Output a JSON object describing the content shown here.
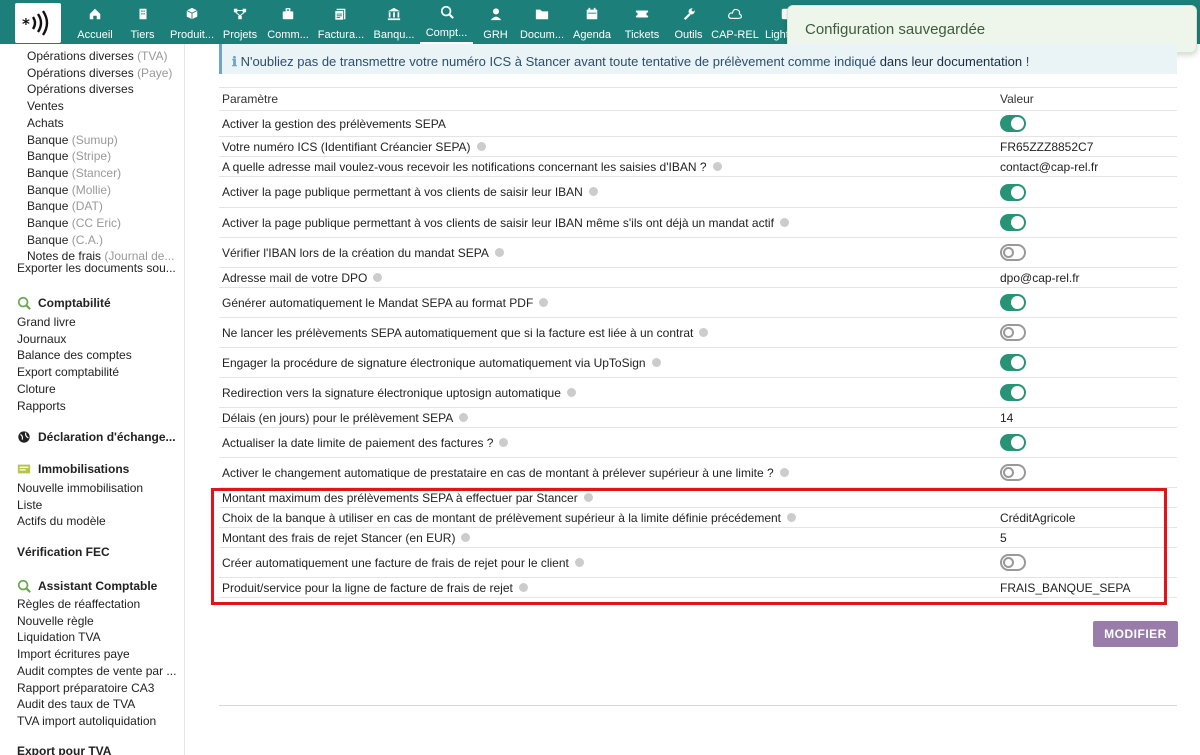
{
  "topbar": {
    "menu": [
      {
        "label": "Accueil",
        "icon": "home-icon"
      },
      {
        "label": "Tiers",
        "icon": "building-icon"
      },
      {
        "label": "Produit...",
        "icon": "cube-icon"
      },
      {
        "label": "Projets",
        "icon": "project-icon"
      },
      {
        "label": "Comm...",
        "icon": "briefcase-icon"
      },
      {
        "label": "Factura...",
        "icon": "invoice-icon"
      },
      {
        "label": "Banqu...",
        "icon": "bank-icon"
      },
      {
        "label": "Compt...",
        "icon": "search-money-icon"
      },
      {
        "label": "GRH",
        "icon": "user-icon"
      },
      {
        "label": "Docum...",
        "icon": "folder-icon"
      },
      {
        "label": "Agenda",
        "icon": "calendar-icon"
      },
      {
        "label": "Tickets",
        "icon": "ticket-icon"
      },
      {
        "label": "Outils",
        "icon": "wrench-icon"
      },
      {
        "label": "CAP-REL",
        "icon": "cloud-icon"
      },
      {
        "label": "Lightpil...",
        "icon": "note-icon"
      }
    ],
    "toast": "Configuration sauvegardée"
  },
  "sidebar": {
    "sub_items": [
      {
        "label": "Opérations diverses",
        "suffix": "(TVA)"
      },
      {
        "label": "Opérations diverses",
        "suffix": "(Paye)"
      },
      {
        "label": "Opérations diverses",
        "suffix": ""
      },
      {
        "label": "Ventes",
        "suffix": ""
      },
      {
        "label": "Achats",
        "suffix": ""
      },
      {
        "label": "Banque",
        "suffix": "(Sumup)"
      },
      {
        "label": "Banque",
        "suffix": "(Stripe)"
      },
      {
        "label": "Banque",
        "suffix": "(Stancer)"
      },
      {
        "label": "Banque",
        "suffix": "(Mollie)"
      },
      {
        "label": "Banque",
        "suffix": "(DAT)"
      },
      {
        "label": "Banque",
        "suffix": "(CC Eric)"
      },
      {
        "label": "Banque",
        "suffix": "(C.A.)"
      },
      {
        "label": "Notes de frais",
        "suffix": "(Journal de..."
      }
    ],
    "export_docs": "Exporter les documents sou...",
    "sections": [
      {
        "title": "Comptabilité",
        "icon": "search-money-icon",
        "items": [
          "Grand livre",
          "Journaux",
          "Balance des comptes",
          "Export comptabilité",
          "Cloture",
          "Rapports"
        ]
      },
      {
        "title": "Déclaration d'échange...",
        "icon": "globe-icon",
        "items": []
      },
      {
        "title": "Immobilisations",
        "icon": "asset-icon",
        "items": [
          "Nouvelle immobilisation",
          "Liste",
          "Actifs du modèle"
        ]
      },
      {
        "title": "Vérification FEC",
        "icon": "",
        "items": []
      },
      {
        "title": "Assistant Comptable",
        "icon": "search-money-icon",
        "items": [
          "Règles de réaffectation",
          "Nouvelle règle",
          "Liquidation TVA",
          "Import écritures paye",
          "Audit comptes de vente par ...",
          "Rapport préparatoire CA3",
          "Audit des taux de TVA",
          "TVA import autoliquidation"
        ]
      },
      {
        "title": "Export pour TVA",
        "icon": "",
        "items": []
      }
    ]
  },
  "info": {
    "text": "N'oubliez pas de transmettre votre numéro ICS à Stancer avant toute tentative de prélèvement comme indiqué",
    "link": "dans leur documentation",
    "suffix": " !"
  },
  "table": {
    "header_param": "Paramètre",
    "header_value": "Valeur",
    "rows": [
      {
        "label": "Activer la gestion des prélèvements SEPA",
        "help": false,
        "type": "toggle",
        "on": true
      },
      {
        "label": "Votre numéro ICS (Identifiant Créancier SEPA)",
        "help": true,
        "type": "text",
        "value": "FR65ZZZ8852C7"
      },
      {
        "label": "A quelle adresse mail voulez-vous recevoir les notifications concernant les saisies d'IBAN ?",
        "help": true,
        "type": "text",
        "value": "contact@cap-rel.fr"
      },
      {
        "label": "Activer la page publique permettant à vos clients de saisir leur IBAN",
        "help": true,
        "type": "toggle",
        "on": true
      },
      {
        "label": "Activer la page publique permettant à vos clients de saisir leur IBAN même s'ils ont déjà un mandat actif",
        "help": true,
        "type": "toggle",
        "on": true
      },
      {
        "label": "Vérifier l'IBAN lors de la création du mandat SEPA",
        "help": true,
        "type": "toggle",
        "on": false
      },
      {
        "label": "Adresse mail de votre DPO",
        "help": true,
        "type": "text",
        "value": "dpo@cap-rel.fr"
      },
      {
        "label": "Générer automatiquement le Mandat SEPA au format PDF",
        "help": true,
        "type": "toggle",
        "on": true
      },
      {
        "label": "Ne lancer les prélèvements SEPA automatiquement que si la facture est liée à un contrat",
        "help": true,
        "type": "toggle",
        "on": false
      },
      {
        "label": "Engager la procédure de signature électronique automatiquement via UpToSign",
        "help": true,
        "type": "toggle",
        "on": true
      },
      {
        "label": "Redirection vers la signature électronique uptosign automatique",
        "help": true,
        "type": "toggle",
        "on": true
      },
      {
        "label": "Délais (en jours) pour le prélèvement SEPA",
        "help": true,
        "type": "text",
        "value": "14"
      },
      {
        "label": "Actualiser la date limite de paiement des factures ?",
        "help": true,
        "type": "toggle",
        "on": true
      },
      {
        "label": "Activer le changement automatique de prestataire en cas de montant à prélever supérieur à une limite ?",
        "help": true,
        "type": "toggle",
        "on": false
      },
      {
        "label": "Montant maximum des prélèvements SEPA à effectuer par Stancer",
        "help": true,
        "type": "text",
        "value": ""
      },
      {
        "label": "Choix de la banque à utiliser en cas de montant de prélèvement supérieur à la limite définie précédement",
        "help": true,
        "type": "text",
        "value": "CréditAgricole"
      },
      {
        "label": "Montant des frais de rejet Stancer (en EUR)",
        "help": true,
        "type": "text",
        "value": "5"
      },
      {
        "label": "Créer automatiquement une facture de frais de rejet pour le client",
        "help": true,
        "type": "toggle",
        "on": false
      },
      {
        "label": "Produit/service pour la ligne de facture de frais de rejet",
        "help": true,
        "type": "text",
        "value": "FRAIS_BANQUE_SEPA"
      }
    ]
  },
  "modify_button": "MODIFIER"
}
